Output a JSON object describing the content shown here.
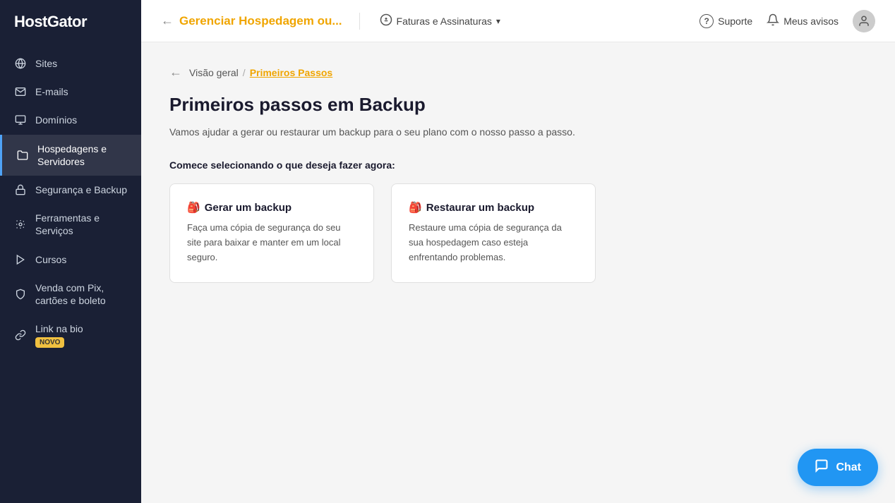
{
  "sidebar": {
    "logo": "HostGator",
    "items": [
      {
        "id": "sites",
        "label": "Sites",
        "icon": "🌐"
      },
      {
        "id": "emails",
        "label": "E-mails",
        "icon": "📧"
      },
      {
        "id": "dominios",
        "label": "Domínios",
        "icon": "🖥"
      },
      {
        "id": "hospedagens",
        "label": "Hospedagens e Servidores",
        "icon": "📁",
        "active": true
      },
      {
        "id": "seguranca",
        "label": "Segurança e Backup",
        "icon": "🔒"
      },
      {
        "id": "ferramentas",
        "label": "Ferramentas e Serviços",
        "icon": "🔧"
      },
      {
        "id": "cursos",
        "label": "Cursos",
        "icon": "▶"
      },
      {
        "id": "venda",
        "label": "Venda com Pix, cartões e boleto",
        "icon": "🛡"
      },
      {
        "id": "link",
        "label": "Link na bio",
        "icon": "🔗",
        "badge": "NOVO"
      }
    ]
  },
  "header": {
    "back_arrow": "←",
    "title": "Gerenciar Hospedagem ou...",
    "billing_label": "Faturas e Assinaturas",
    "billing_icon": "💲",
    "support_label": "Suporte",
    "support_icon": "?",
    "notifications_label": "Meus avisos",
    "notifications_icon": "🔔"
  },
  "breadcrumb": {
    "back_arrow": "←",
    "parent": "Visão geral",
    "separator": "/",
    "current": "Primeiros Passos"
  },
  "page": {
    "title": "Primeiros passos em Backup",
    "subtitle": "Vamos ajudar a gerar ou restaurar um backup para o seu plano com o nosso passo a passo.",
    "section_label": "Comece selecionando o que deseja fazer agora:"
  },
  "cards": [
    {
      "icon": "🎒",
      "title": "Gerar um backup",
      "description": "Faça uma cópia de segurança do seu site para baixar e manter em um local seguro."
    },
    {
      "icon": "🎒",
      "title": "Restaurar um backup",
      "description": "Restaure uma cópia de segurança da sua hospedagem caso esteja enfrentando problemas."
    }
  ],
  "chat": {
    "label": "Chat",
    "icon": "💬"
  }
}
